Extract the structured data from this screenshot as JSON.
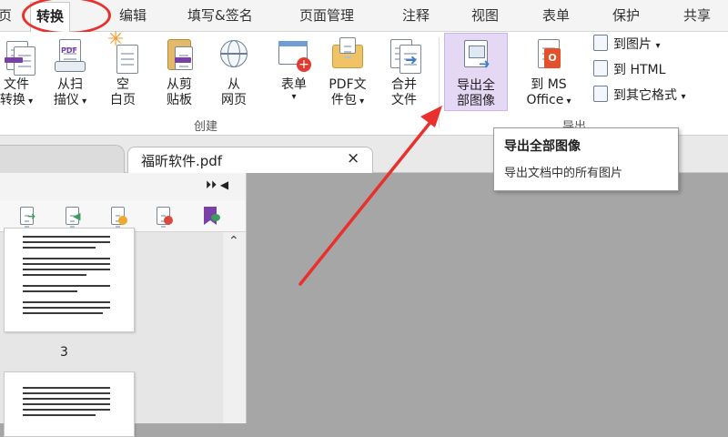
{
  "menu": {
    "tabs": [
      "页",
      "转换",
      "编辑",
      "填写&签名",
      "页面管理",
      "注释",
      "视图",
      "表单",
      "保护",
      "共享"
    ],
    "active_index": 1
  },
  "ribbon": {
    "buttons": [
      {
        "label": "文件\n转换",
        "icon": "file-convert-icon",
        "dropdown": true
      },
      {
        "label": "从扫\n描仪",
        "icon": "scanner-icon",
        "dropdown": true
      },
      {
        "label": "空\n白页",
        "icon": "blank-page-icon",
        "dropdown": false
      },
      {
        "label": "从剪\n贴板",
        "icon": "clipboard-icon",
        "dropdown": false
      },
      {
        "label": "从\n网页",
        "icon": "globe-icon",
        "dropdown": false
      },
      {
        "label": "表单",
        "icon": "form-icon",
        "dropdown": true
      },
      {
        "label": "PDF文\n件包",
        "icon": "pdf-package-icon",
        "dropdown": true
      },
      {
        "label": "合并\n文件",
        "icon": "merge-files-icon",
        "dropdown": false
      },
      {
        "label": "导出全\n部图像",
        "icon": "export-images-icon",
        "dropdown": false
      },
      {
        "label": "到 MS\nOffice",
        "icon": "office-icon",
        "dropdown": true
      }
    ],
    "group_create": "创建",
    "group_export": "导出",
    "small_buttons": [
      {
        "label": "到图片",
        "dropdown": true
      },
      {
        "label": "到 HTML",
        "dropdown": false
      },
      {
        "label": "到其它格式",
        "dropdown": true
      }
    ],
    "pdf_badge": "PDF"
  },
  "tabs": {
    "document": "福昕软件.pdf",
    "close_symbol": "×"
  },
  "panel": {
    "collapse_symbols": "⏵⏵ ◀",
    "scroll_up": "⌃",
    "page_number": "3"
  },
  "tooltip": {
    "title": "导出全部图像",
    "description": "导出文档中的所有图片"
  },
  "colors": {
    "accent_red": "#e8312c",
    "highlight": "#e5d8f5",
    "canvas": "#a6a6a6"
  }
}
